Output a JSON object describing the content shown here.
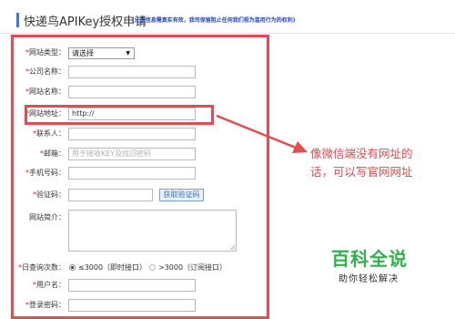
{
  "header": {
    "title": "快递鸟APIKey授权申请",
    "note": "(注册信息需真实有效，我司保留阻止任何我们视为滥用行为的权利)"
  },
  "form": {
    "site_type": {
      "label": "网站类型：",
      "value": "请选择"
    },
    "company": {
      "label": "公司名称：",
      "value": ""
    },
    "site_name": {
      "label": "网站名称：",
      "value": ""
    },
    "site_url": {
      "label": "网站地址：",
      "value": "http://"
    },
    "contact": {
      "label": "联系人：",
      "value": ""
    },
    "email": {
      "label": "邮箱：",
      "placeholder": "用于接收KEY及找回密码"
    },
    "phone": {
      "label": "手机号码：",
      "value": ""
    },
    "captcha": {
      "label": "验证码：",
      "value": "",
      "button": "获取验证码"
    },
    "intro": {
      "label": "网站简介："
    },
    "daily": {
      "label": "日查询次数：",
      "options": [
        "≤3000（即时接口）",
        ">3000（订阅接口）"
      ],
      "selected": 0
    },
    "username": {
      "label": "用户名：",
      "value": ""
    },
    "password": {
      "label": "登录密码：",
      "value": ""
    }
  },
  "annotation": {
    "line1": "像微信端没有网址的",
    "line2": "话，可以写官网网址"
  },
  "watermark": {
    "title": "百科全说",
    "subtitle": "助你轻松解决"
  },
  "colors": {
    "highlight": "#e84a4f",
    "accent": "#3a7bd5",
    "watermark": "#2fb24a"
  }
}
